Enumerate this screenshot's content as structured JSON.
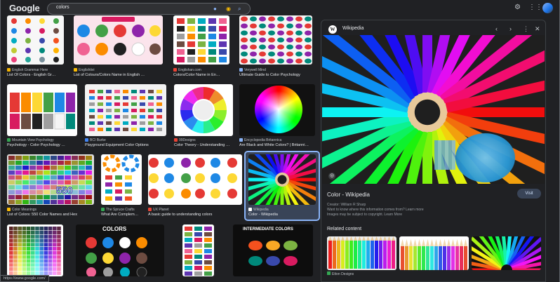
{
  "header": {
    "logo": "Google",
    "query": "colors",
    "icons": [
      "mic-icon",
      "lens-icon",
      "search-icon",
      "gear-icon",
      "apps-icon",
      "avatar"
    ]
  },
  "grid": {
    "row1": [
      {
        "source": "English Grammar Here",
        "title": "List Of Colors - English Gr…"
      },
      {
        "source": "Englishtivi",
        "title": "List of Colours/Colors Name in English …"
      },
      {
        "source": "Englishan.com",
        "title": "Colors/Color Name in En…"
      },
      {
        "source": "Verywell Mind",
        "title": "Ultimate Guide to Color Psychology"
      }
    ],
    "row2": [
      {
        "source": "Mountain View Psychology",
        "title": "Psychology - Color Psychology …"
      },
      {
        "source": "BCI Burke",
        "title": "Playground Equipment Color Options"
      },
      {
        "source": "99Designs",
        "title": "Color Theory - Understanding …"
      },
      {
        "source": "Encyclopedia Britannica",
        "title": "Are Black and White Colors? | Britanni…"
      }
    ],
    "row3": [
      {
        "source": "Color Meanings",
        "title": "List of Colors: 550 Color Names and Hex"
      },
      {
        "source": "The Spruce Crafts",
        "title": "What Are Complem…"
      },
      {
        "source": "UX Planet",
        "title": "A basic guide to understanding colors"
      },
      {
        "source": "Wikipedia",
        "title": "Color - Wikipedia"
      }
    ],
    "row4": [
      {
        "source": "",
        "title": ""
      },
      {
        "source": "Pinterest",
        "title": "",
        "label": "COLORS"
      },
      {
        "source": "Etsy",
        "title": ""
      },
      {
        "source": "",
        "title": "",
        "label": "INTERMEDIATE COLORS"
      }
    ],
    "badge_550": "550",
    "badge_colors": "COLORS"
  },
  "panel": {
    "source": "Wikipedia",
    "title": "Color - Wikipedia",
    "visit": "Visit",
    "credit1": "Creator: William R Sharp",
    "credit2": "Want to know where this information comes from? Learn more",
    "credit3": "Images may be subject to copyright. Learn More",
    "related_heading": "Related content",
    "related": [
      {
        "source": "Etton Designs"
      },
      {
        "source": ""
      },
      {
        "source": ""
      }
    ]
  },
  "status_url": "https://www.google.com/",
  "colors": {
    "bg": "#202124",
    "accent": "#8ab4f8",
    "text": "#e8eaed",
    "muted": "#bdc1c6"
  }
}
